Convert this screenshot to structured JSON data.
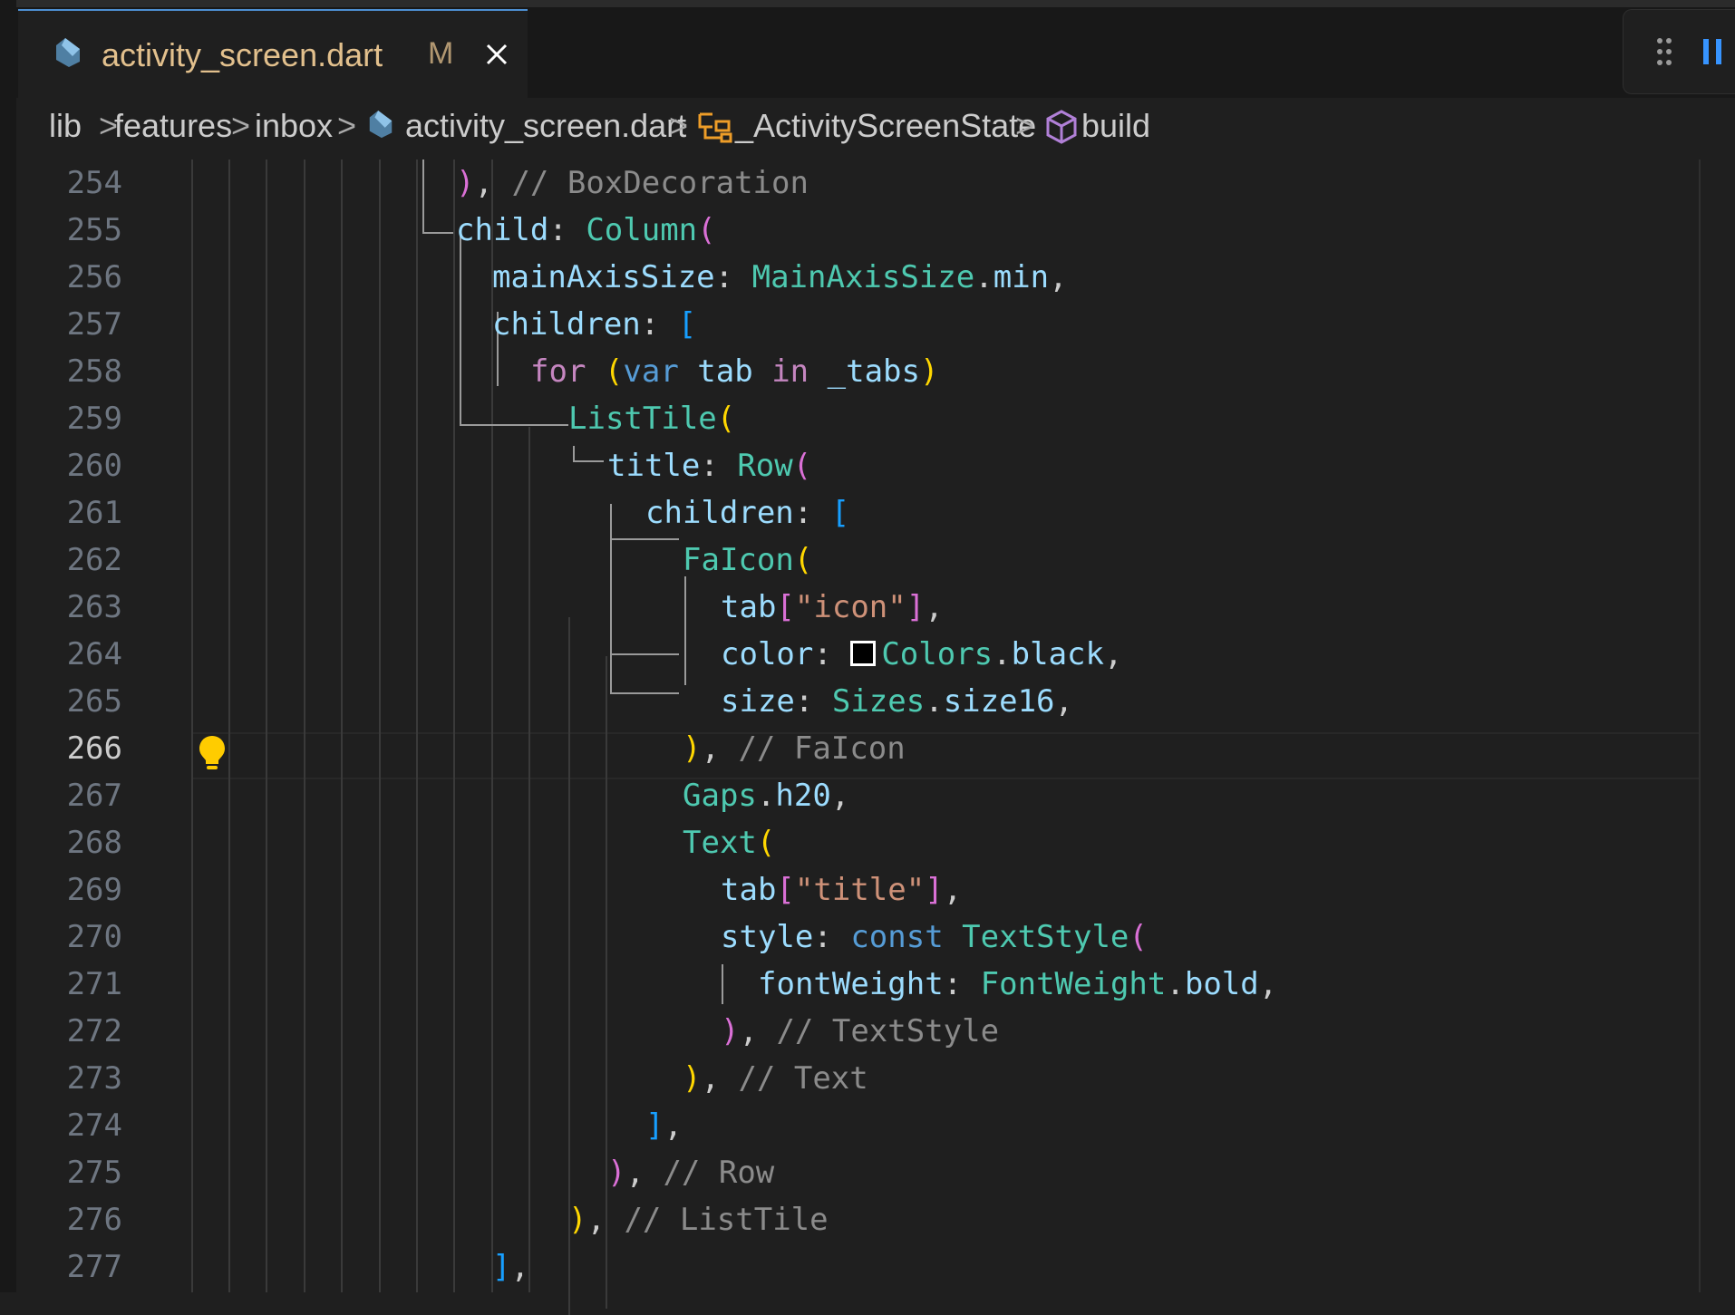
{
  "tab": {
    "filename": "activity_screen.dart",
    "status": "M"
  },
  "breadcrumbs": {
    "items": [
      "lib",
      "features",
      "inbox",
      "activity_screen.dart",
      "_ActivityScreenState",
      "build"
    ],
    "separator": ">"
  },
  "editor": {
    "current_line": 266,
    "lines": [
      {
        "n": 254,
        "tokens": [
          {
            "t": ")",
            "c": "p2"
          },
          {
            "t": ", ",
            "c": "pl"
          },
          {
            "t": "// BoxDecoration",
            "c": "cm"
          }
        ]
      },
      {
        "n": 255,
        "tokens": [
          {
            "t": "child",
            "c": "prop"
          },
          {
            "t": ": ",
            "c": "pl"
          },
          {
            "t": "Column",
            "c": "cls"
          },
          {
            "t": "(",
            "c": "p2"
          }
        ]
      },
      {
        "n": 256,
        "tokens": [
          {
            "t": "mainAxisSize",
            "c": "prop"
          },
          {
            "t": ": ",
            "c": "pl"
          },
          {
            "t": "MainAxisSize",
            "c": "cls"
          },
          {
            "t": ".",
            "c": "pl"
          },
          {
            "t": "min",
            "c": "prop"
          },
          {
            "t": ",",
            "c": "pl"
          }
        ]
      },
      {
        "n": 257,
        "tokens": [
          {
            "t": "children",
            "c": "prop"
          },
          {
            "t": ": ",
            "c": "pl"
          },
          {
            "t": "[",
            "c": "p3"
          }
        ]
      },
      {
        "n": 258,
        "tokens": [
          {
            "t": "for",
            "c": "kw"
          },
          {
            "t": " ",
            "c": "pl"
          },
          {
            "t": "(",
            "c": "p1"
          },
          {
            "t": "var",
            "c": "kw2"
          },
          {
            "t": " ",
            "c": "pl"
          },
          {
            "t": "tab",
            "c": "prop"
          },
          {
            "t": " ",
            "c": "pl"
          },
          {
            "t": "in",
            "c": "kw"
          },
          {
            "t": " ",
            "c": "pl"
          },
          {
            "t": "_tabs",
            "c": "prop"
          },
          {
            "t": ")",
            "c": "p1"
          }
        ]
      },
      {
        "n": 259,
        "tokens": [
          {
            "t": "ListTile",
            "c": "cls"
          },
          {
            "t": "(",
            "c": "p1"
          }
        ]
      },
      {
        "n": 260,
        "tokens": [
          {
            "t": "title",
            "c": "prop"
          },
          {
            "t": ": ",
            "c": "pl"
          },
          {
            "t": "Row",
            "c": "cls"
          },
          {
            "t": "(",
            "c": "p2"
          }
        ]
      },
      {
        "n": 261,
        "tokens": [
          {
            "t": "children",
            "c": "prop"
          },
          {
            "t": ": ",
            "c": "pl"
          },
          {
            "t": "[",
            "c": "p3"
          }
        ]
      },
      {
        "n": 262,
        "tokens": [
          {
            "t": "FaIcon",
            "c": "cls"
          },
          {
            "t": "(",
            "c": "p1"
          }
        ]
      },
      {
        "n": 263,
        "tokens": [
          {
            "t": "tab",
            "c": "prop"
          },
          {
            "t": "[",
            "c": "p2"
          },
          {
            "t": "\"icon\"",
            "c": "str"
          },
          {
            "t": "]",
            "c": "p2"
          },
          {
            "t": ",",
            "c": "pl"
          }
        ]
      },
      {
        "n": 264,
        "tokens": [
          {
            "t": "color",
            "c": "prop"
          },
          {
            "t": ": ",
            "c": "pl"
          },
          {
            "t": "__swatch__",
            "c": "sw"
          },
          {
            "t": "Colors",
            "c": "cls"
          },
          {
            "t": ".",
            "c": "pl"
          },
          {
            "t": "black",
            "c": "prop"
          },
          {
            "t": ",",
            "c": "pl"
          }
        ]
      },
      {
        "n": 265,
        "tokens": [
          {
            "t": "size",
            "c": "prop"
          },
          {
            "t": ": ",
            "c": "pl"
          },
          {
            "t": "Sizes",
            "c": "cls"
          },
          {
            "t": ".",
            "c": "pl"
          },
          {
            "t": "size16",
            "c": "prop"
          },
          {
            "t": ",",
            "c": "pl"
          }
        ]
      },
      {
        "n": 266,
        "tokens": [
          {
            "t": ")",
            "c": "p1"
          },
          {
            "t": ", ",
            "c": "pl"
          },
          {
            "t": "// FaIcon",
            "c": "cm"
          }
        ]
      },
      {
        "n": 267,
        "tokens": [
          {
            "t": "Gaps",
            "c": "cls"
          },
          {
            "t": ".",
            "c": "pl"
          },
          {
            "t": "h20",
            "c": "prop"
          },
          {
            "t": ",",
            "c": "pl"
          }
        ]
      },
      {
        "n": 268,
        "tokens": [
          {
            "t": "Text",
            "c": "cls"
          },
          {
            "t": "(",
            "c": "p1"
          }
        ]
      },
      {
        "n": 269,
        "tokens": [
          {
            "t": "tab",
            "c": "prop"
          },
          {
            "t": "[",
            "c": "p2"
          },
          {
            "t": "\"title\"",
            "c": "str"
          },
          {
            "t": "]",
            "c": "p2"
          },
          {
            "t": ",",
            "c": "pl"
          }
        ]
      },
      {
        "n": 270,
        "tokens": [
          {
            "t": "style",
            "c": "prop"
          },
          {
            "t": ": ",
            "c": "pl"
          },
          {
            "t": "const",
            "c": "kw2"
          },
          {
            "t": " ",
            "c": "pl"
          },
          {
            "t": "TextStyle",
            "c": "cls"
          },
          {
            "t": "(",
            "c": "p2"
          }
        ]
      },
      {
        "n": 271,
        "tokens": [
          {
            "t": "fontWeight",
            "c": "prop"
          },
          {
            "t": ": ",
            "c": "pl"
          },
          {
            "t": "FontWeight",
            "c": "cls"
          },
          {
            "t": ".",
            "c": "pl"
          },
          {
            "t": "bold",
            "c": "prop"
          },
          {
            "t": ",",
            "c": "pl"
          }
        ]
      },
      {
        "n": 272,
        "tokens": [
          {
            "t": ")",
            "c": "p2"
          },
          {
            "t": ", ",
            "c": "pl"
          },
          {
            "t": "// TextStyle",
            "c": "cm"
          }
        ]
      },
      {
        "n": 273,
        "tokens": [
          {
            "t": ")",
            "c": "p1"
          },
          {
            "t": ", ",
            "c": "pl"
          },
          {
            "t": "// Text",
            "c": "cm"
          }
        ]
      },
      {
        "n": 274,
        "tokens": [
          {
            "t": "]",
            "c": "p3"
          },
          {
            "t": ",",
            "c": "pl"
          }
        ]
      },
      {
        "n": 275,
        "tokens": [
          {
            "t": ")",
            "c": "p2"
          },
          {
            "t": ", ",
            "c": "pl"
          },
          {
            "t": "// Row",
            "c": "cm"
          }
        ]
      },
      {
        "n": 276,
        "tokens": [
          {
            "t": ")",
            "c": "p1"
          },
          {
            "t": ", ",
            "c": "pl"
          },
          {
            "t": "// ListTile",
            "c": "cm"
          }
        ]
      },
      {
        "n": 277,
        "tokens": [
          {
            "t": "]",
            "c": "p3"
          },
          {
            "t": ",",
            "c": "pl"
          }
        ]
      }
    ]
  },
  "icons": {
    "tab_file": "dart-file-icon",
    "tab_close": "close-icon",
    "breadcrumb_file": "dart-file-icon",
    "breadcrumb_class": "class-icon",
    "breadcrumb_method": "method-cube-icon",
    "lightbulb": "lightbulb-icon",
    "toolbar": [
      "drag-handle-icon",
      "pause-icon"
    ]
  },
  "colors": {
    "background": "#1f1f1f",
    "tab_modified_text": "#e2c08d",
    "active_tab_border": "#4d8fd1",
    "keyword": "#c586c0",
    "type": "#4ec9b0",
    "property": "#9cdcfe",
    "string": "#ce9178",
    "comment": "#8b8b8b",
    "bracket_gold": "#ffd700",
    "bracket_orchid": "#da70d6",
    "bracket_blue": "#179fff"
  }
}
